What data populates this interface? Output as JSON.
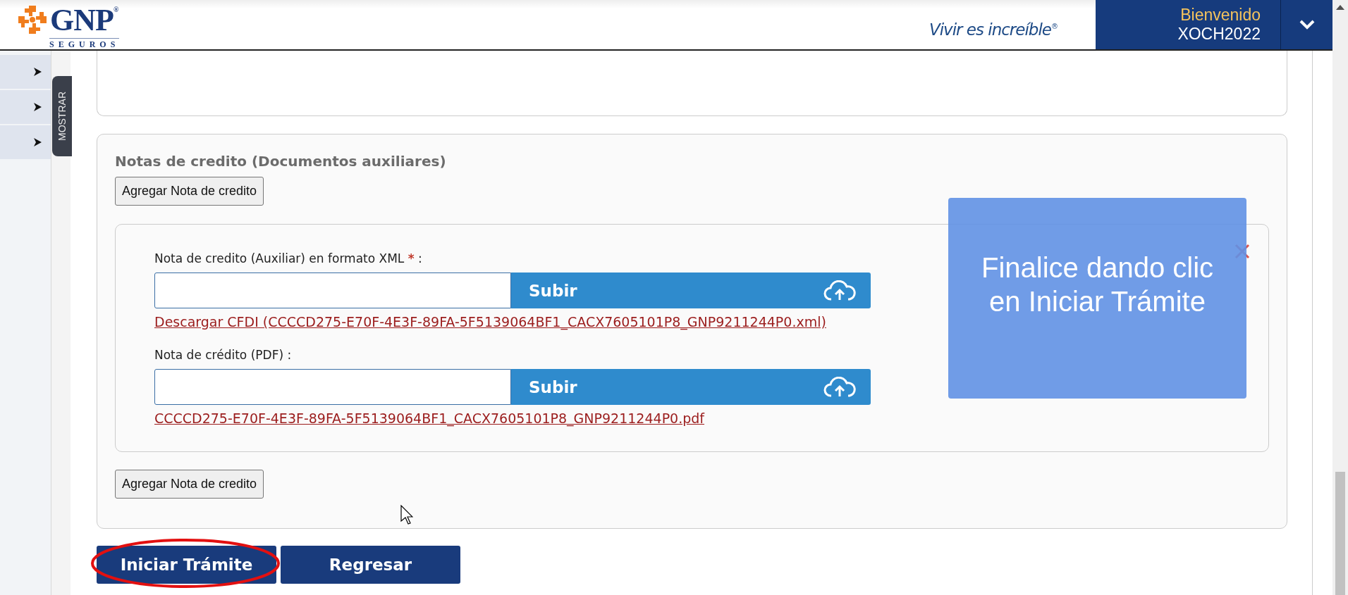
{
  "header": {
    "logo": {
      "name": "GNP",
      "registered": "®",
      "subtitle": "SEGUROS"
    },
    "slogan": "Vivir es increíble",
    "slogan_mark": "®",
    "user": {
      "greeting": "Bienvenido",
      "username": "XOCH2022"
    }
  },
  "sidebar": {
    "items": [
      {
        "expanded": false
      },
      {
        "expanded": false
      },
      {
        "expanded": false
      }
    ],
    "toggle_label": "MOSTRAR"
  },
  "section": {
    "title": "Notas de credito (Documentos auxiliares)",
    "add_button": "Agregar Nota de credito",
    "documents": [
      {
        "label": "Nota de credito (Auxiliar) en formato XML",
        "required_mark": "*",
        "colon": ":",
        "upload_button": "Subir",
        "link": "Descargar CFDI (CCCCD275-E70F-4E3F-89FA-5F5139064BF1_CACX7605101P8_GNP9211244P0.xml)"
      },
      {
        "label": "Nota de crédito (PDF)",
        "colon": ":",
        "upload_button": "Subir",
        "link": "CCCCD275-E70F-4E3F-89FA-5F5139064BF1_CACX7605101P8_GNP9211244P0.pdf"
      }
    ],
    "add_button_bottom": "Agregar Nota de credito"
  },
  "actions": [
    {
      "label": "Iniciar Trámite",
      "highlighted": true
    },
    {
      "label": "Regresar",
      "highlighted": false
    }
  ],
  "tooltip": {
    "text": "Finalice dando clic en Iniciar Trámite"
  }
}
